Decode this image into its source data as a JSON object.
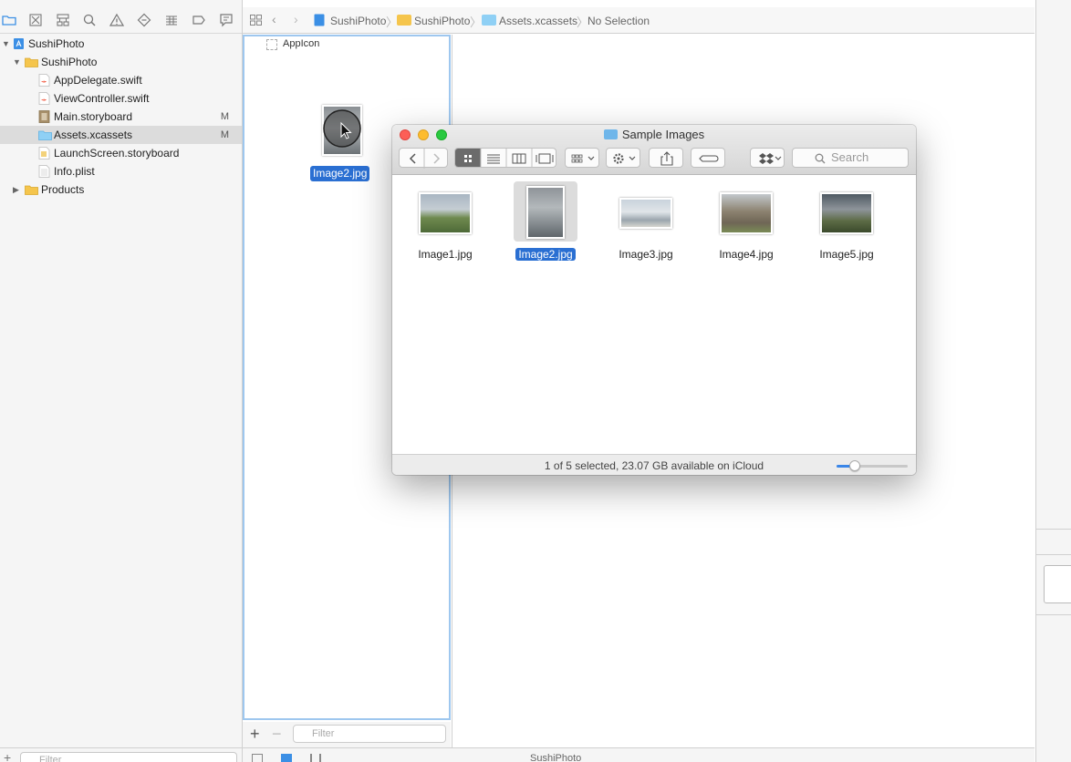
{
  "navigator": {
    "toolbar_icons": [
      "folder-icon",
      "source-control-icon",
      "hierarchy-icon",
      "search-icon",
      "warning-icon",
      "test-icon",
      "debug-icon",
      "breakpoint-icon",
      "report-icon"
    ],
    "items": [
      {
        "label": "SushiPhoto",
        "type": "project",
        "expanded": true,
        "badge": ""
      },
      {
        "label": "SushiPhoto",
        "type": "group",
        "expanded": true,
        "badge": ""
      },
      {
        "label": "AppDelegate.swift",
        "type": "swift",
        "badge": ""
      },
      {
        "label": "ViewController.swift",
        "type": "swift",
        "badge": ""
      },
      {
        "label": "Main.storyboard",
        "type": "storyboard",
        "badge": "M"
      },
      {
        "label": "Assets.xcassets",
        "type": "assets",
        "badge": "M",
        "selected": true
      },
      {
        "label": "LaunchScreen.storyboard",
        "type": "storyboard",
        "badge": ""
      },
      {
        "label": "Info.plist",
        "type": "plist",
        "badge": ""
      },
      {
        "label": "Products",
        "type": "group",
        "expanded": false,
        "badge": ""
      }
    ],
    "filter_placeholder": "Filter"
  },
  "breadcrumb": {
    "items": [
      "SushiPhoto",
      "SushiPhoto",
      "Assets.xcassets",
      "No Selection"
    ]
  },
  "asset_catalog": {
    "items": [
      "AppIcon"
    ],
    "filter_placeholder": "Filter",
    "dragging_label": "Image2.jpg"
  },
  "debug_bar": {
    "scheme": "SushiPhoto"
  },
  "finder": {
    "title": "Sample Images",
    "search_placeholder": "Search",
    "files": [
      {
        "name": "Image1.jpg",
        "selected": false,
        "orientation": "landscape"
      },
      {
        "name": "Image2.jpg",
        "selected": true,
        "orientation": "portrait"
      },
      {
        "name": "Image3.jpg",
        "selected": false,
        "orientation": "landscape"
      },
      {
        "name": "Image4.jpg",
        "selected": false,
        "orientation": "landscape"
      },
      {
        "name": "Image5.jpg",
        "selected": false,
        "orientation": "landscape"
      }
    ],
    "status": "1 of 5 selected, 23.07 GB available on iCloud",
    "icon_size_level": 0.25
  },
  "colors": {
    "selection_blue": "#2a6fd2",
    "folder_blue": "#6fb6ea",
    "folder_yellow": "#f5c54c",
    "close": "#fc5f57",
    "minimize": "#fdbc2e",
    "zoom": "#29c940"
  }
}
